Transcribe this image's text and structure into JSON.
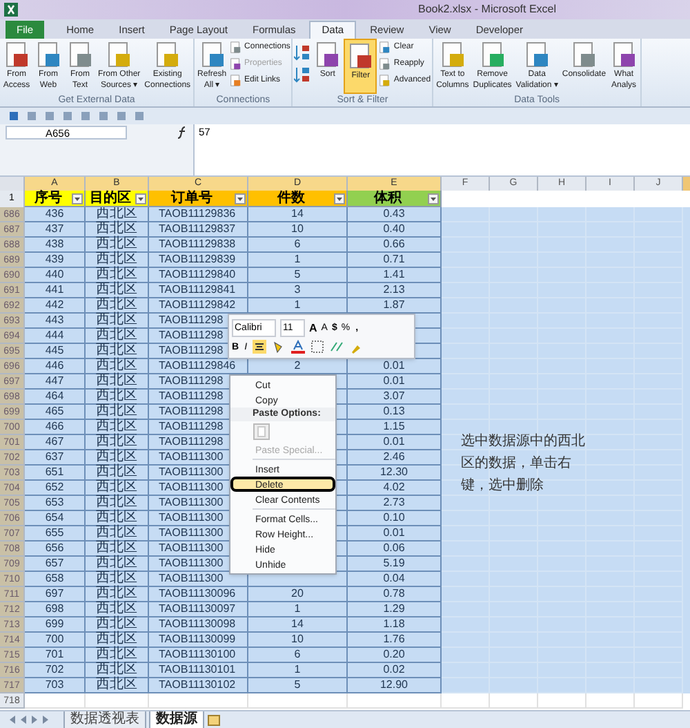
{
  "window": {
    "title": "Book2.xlsx - Microsoft Excel"
  },
  "tabs": [
    {
      "label": "File",
      "kind": "file"
    },
    {
      "label": "Home",
      "kind": "tab",
      "selected": false
    },
    {
      "label": "Insert",
      "kind": "tab",
      "selected": false
    },
    {
      "label": "Page Layout",
      "kind": "tab",
      "selected": false
    },
    {
      "label": "Formulas",
      "kind": "tab",
      "selected": false
    },
    {
      "label": "Data",
      "kind": "tab",
      "selected": true
    },
    {
      "label": "Review",
      "kind": "tab",
      "selected": false
    },
    {
      "label": "View",
      "kind": "tab",
      "selected": false
    },
    {
      "label": "Developer",
      "kind": "tab",
      "selected": false
    }
  ],
  "ribbon": {
    "groups": [
      {
        "title": "Get External Data",
        "buttons": [
          {
            "lines": [
              "From",
              "Access"
            ],
            "kind": "large"
          },
          {
            "lines": [
              "From",
              "Web"
            ],
            "kind": "large"
          },
          {
            "lines": [
              "From",
              "Text"
            ],
            "kind": "large"
          },
          {
            "lines": [
              "From Other",
              "Sources ▾"
            ],
            "kind": "large"
          },
          {
            "lines": [
              "Existing",
              "Connections"
            ],
            "kind": "large"
          }
        ]
      },
      {
        "title": "Connections",
        "buttons": [
          {
            "lines": [
              "Refresh",
              "All ▾"
            ],
            "kind": "large"
          },
          {
            "lines": [
              "Connections"
            ],
            "kind": "small",
            "disabled": false
          },
          {
            "lines": [
              "Properties"
            ],
            "kind": "small",
            "disabled": true
          },
          {
            "lines": [
              "Edit Links"
            ],
            "kind": "small",
            "disabled": false
          }
        ]
      },
      {
        "title": "Sort & Filter",
        "buttons": [
          {
            "kind": "sort-pair"
          },
          {
            "lines": [
              "Sort"
            ],
            "kind": "large"
          },
          {
            "lines": [
              "Filter"
            ],
            "kind": "large",
            "selected": true
          },
          {
            "lines": [
              "Clear"
            ],
            "kind": "small",
            "disabled": false
          },
          {
            "lines": [
              "Reapply"
            ],
            "kind": "small",
            "disabled": false
          },
          {
            "lines": [
              "Advanced"
            ],
            "kind": "small",
            "disabled": false
          }
        ]
      },
      {
        "title": "Data Tools",
        "buttons": [
          {
            "lines": [
              "Text to",
              "Columns"
            ],
            "kind": "large"
          },
          {
            "lines": [
              "Remove",
              "Duplicates"
            ],
            "kind": "large"
          },
          {
            "lines": [
              "Data",
              "Validation ▾"
            ],
            "kind": "large"
          },
          {
            "lines": [
              "Consolidate"
            ],
            "kind": "large"
          },
          {
            "lines": [
              "What",
              "Analys"
            ],
            "kind": "large"
          }
        ]
      }
    ]
  },
  "formula_bar": {
    "name_box": "A656",
    "value": "57"
  },
  "columns": [
    "A",
    "B",
    "C",
    "D",
    "E",
    "F",
    "G",
    "H",
    "I",
    "J"
  ],
  "header_row": {
    "number": "1",
    "cells": [
      {
        "label": "序号",
        "color": "#ffff00"
      },
      {
        "label": "目的区",
        "color": "#ffff00"
      },
      {
        "label": "订单号",
        "color": "#ffc000"
      },
      {
        "label": "件数",
        "color": "#ffc000"
      },
      {
        "label": "体积",
        "color": "#92d050"
      }
    ]
  },
  "rows": [
    {
      "number": "686",
      "selected": true,
      "a": "436",
      "b": "西北区",
      "c": "TAOB11129836",
      "d": "14",
      "e": "0.43"
    },
    {
      "number": "687",
      "selected": true,
      "a": "437",
      "b": "西北区",
      "c": "TAOB11129837",
      "d": "10",
      "e": "0.40"
    },
    {
      "number": "688",
      "selected": true,
      "a": "438",
      "b": "西北区",
      "c": "TAOB11129838",
      "d": "6",
      "e": "0.66"
    },
    {
      "number": "689",
      "selected": true,
      "a": "439",
      "b": "西北区",
      "c": "TAOB11129839",
      "d": "1",
      "e": "0.71"
    },
    {
      "number": "690",
      "selected": true,
      "a": "440",
      "b": "西北区",
      "c": "TAOB11129840",
      "d": "5",
      "e": "1.41"
    },
    {
      "number": "691",
      "selected": true,
      "a": "441",
      "b": "西北区",
      "c": "TAOB11129841",
      "d": "3",
      "e": "2.13"
    },
    {
      "number": "692",
      "selected": true,
      "a": "442",
      "b": "西北区",
      "c": "TAOB11129842",
      "d": "1",
      "e": "1.87"
    },
    {
      "number": "693",
      "selected": true,
      "a": "443",
      "b": "西北区",
      "c": "TAOB111298"
    },
    {
      "number": "694",
      "selected": true,
      "a": "444",
      "b": "西北区",
      "c": "TAOB111298"
    },
    {
      "number": "695",
      "selected": true,
      "a": "445",
      "b": "西北区",
      "c": "TAOB111298"
    },
    {
      "number": "696",
      "selected": true,
      "a": "446",
      "b": "西北区",
      "c": "TAOB11129846",
      "d": "2",
      "e": "0.01"
    },
    {
      "number": "697",
      "selected": true,
      "a": "447",
      "b": "西北区",
      "c": "TAOB111298",
      "e": "0.01"
    },
    {
      "number": "698",
      "selected": true,
      "a": "464",
      "b": "西北区",
      "c": "TAOB111298",
      "e": "3.07"
    },
    {
      "number": "699",
      "selected": true,
      "a": "465",
      "b": "西北区",
      "c": "TAOB111298",
      "e": "0.13"
    },
    {
      "number": "700",
      "selected": true,
      "a": "466",
      "b": "西北区",
      "c": "TAOB111298",
      "e": "1.15"
    },
    {
      "number": "701",
      "selected": true,
      "a": "467",
      "b": "西北区",
      "c": "TAOB111298",
      "e": "0.01"
    },
    {
      "number": "702",
      "selected": true,
      "a": "637",
      "b": "西北区",
      "c": "TAOB111300",
      "e": "2.46"
    },
    {
      "number": "703",
      "selected": true,
      "a": "651",
      "b": "西北区",
      "c": "TAOB111300",
      "e": "12.30"
    },
    {
      "number": "704",
      "selected": true,
      "a": "652",
      "b": "西北区",
      "c": "TAOB111300",
      "e": "4.02"
    },
    {
      "number": "705",
      "selected": true,
      "a": "653",
      "b": "西北区",
      "c": "TAOB111300",
      "e": "2.73"
    },
    {
      "number": "706",
      "selected": true,
      "a": "654",
      "b": "西北区",
      "c": "TAOB111300",
      "e": "0.10"
    },
    {
      "number": "707",
      "selected": true,
      "a": "655",
      "b": "西北区",
      "c": "TAOB111300",
      "e": "0.01"
    },
    {
      "number": "708",
      "selected": true,
      "a": "656",
      "b": "西北区",
      "c": "TAOB111300",
      "e": "0.06"
    },
    {
      "number": "709",
      "selected": true,
      "a": "657",
      "b": "西北区",
      "c": "TAOB111300",
      "e": "5.19"
    },
    {
      "number": "710",
      "selected": true,
      "a": "658",
      "b": "西北区",
      "c": "TAOB111300",
      "e": "0.04"
    },
    {
      "number": "711",
      "selected": true,
      "a": "697",
      "b": "西北区",
      "c": "TAOB11130096",
      "d": "20",
      "e": "0.78"
    },
    {
      "number": "712",
      "selected": true,
      "a": "698",
      "b": "西北区",
      "c": "TAOB11130097",
      "d": "1",
      "e": "1.29"
    },
    {
      "number": "713",
      "selected": true,
      "a": "699",
      "b": "西北区",
      "c": "TAOB11130098",
      "d": "14",
      "e": "1.18"
    },
    {
      "number": "714",
      "selected": true,
      "a": "700",
      "b": "西北区",
      "c": "TAOB11130099",
      "d": "10",
      "e": "1.76"
    },
    {
      "number": "715",
      "selected": true,
      "a": "701",
      "b": "西北区",
      "c": "TAOB11130100",
      "d": "6",
      "e": "0.20"
    },
    {
      "number": "716",
      "selected": true,
      "a": "702",
      "b": "西北区",
      "c": "TAOB11130101",
      "d": "1",
      "e": "0.02"
    },
    {
      "number": "717",
      "selected": true,
      "a": "703",
      "b": "西北区",
      "c": "TAOB11130102",
      "d": "5",
      "e": "12.90"
    },
    {
      "number": "718",
      "selected": false
    }
  ],
  "note": "选中数据源中的西北区的数据，单击右键，选中删除",
  "mini_toolbar": {
    "font": "Calibri",
    "size": "11",
    "grow_font": "A",
    "shrink_font": "A",
    "bold": "B",
    "italic": "I",
    "currency": "$",
    "percent": "%",
    "comma": ",",
    "center_selected": true
  },
  "context_menu": [
    {
      "kind": "item",
      "label": "Cut",
      "disabled": false,
      "highlighted": false,
      "circled": false
    },
    {
      "kind": "item",
      "label": "Copy",
      "disabled": false,
      "highlighted": false,
      "circled": false
    },
    {
      "kind": "header",
      "label": "Paste Options:"
    },
    {
      "kind": "paste-icon"
    },
    {
      "kind": "item",
      "label": "Paste Special...",
      "disabled": true,
      "highlighted": false,
      "circled": false
    },
    {
      "kind": "separator"
    },
    {
      "kind": "item",
      "label": "Insert",
      "disabled": false,
      "highlighted": false,
      "circled": false
    },
    {
      "kind": "item",
      "label": "Delete",
      "disabled": false,
      "highlighted": true,
      "circled": true
    },
    {
      "kind": "item",
      "label": "Clear Contents",
      "disabled": false,
      "highlighted": false,
      "circled": false
    },
    {
      "kind": "separator"
    },
    {
      "kind": "item",
      "label": "Format Cells...",
      "disabled": false,
      "highlighted": false,
      "circled": false
    },
    {
      "kind": "item",
      "label": "Row Height...",
      "disabled": false,
      "highlighted": false,
      "circled": false
    },
    {
      "kind": "item",
      "label": "Hide",
      "disabled": false,
      "highlighted": false,
      "circled": false
    },
    {
      "kind": "item",
      "label": "Unhide",
      "disabled": false,
      "highlighted": false,
      "circled": false
    }
  ],
  "sheet_tabs": [
    {
      "label": "数据透视表",
      "selected": false
    },
    {
      "label": "数据源",
      "selected": true
    }
  ]
}
